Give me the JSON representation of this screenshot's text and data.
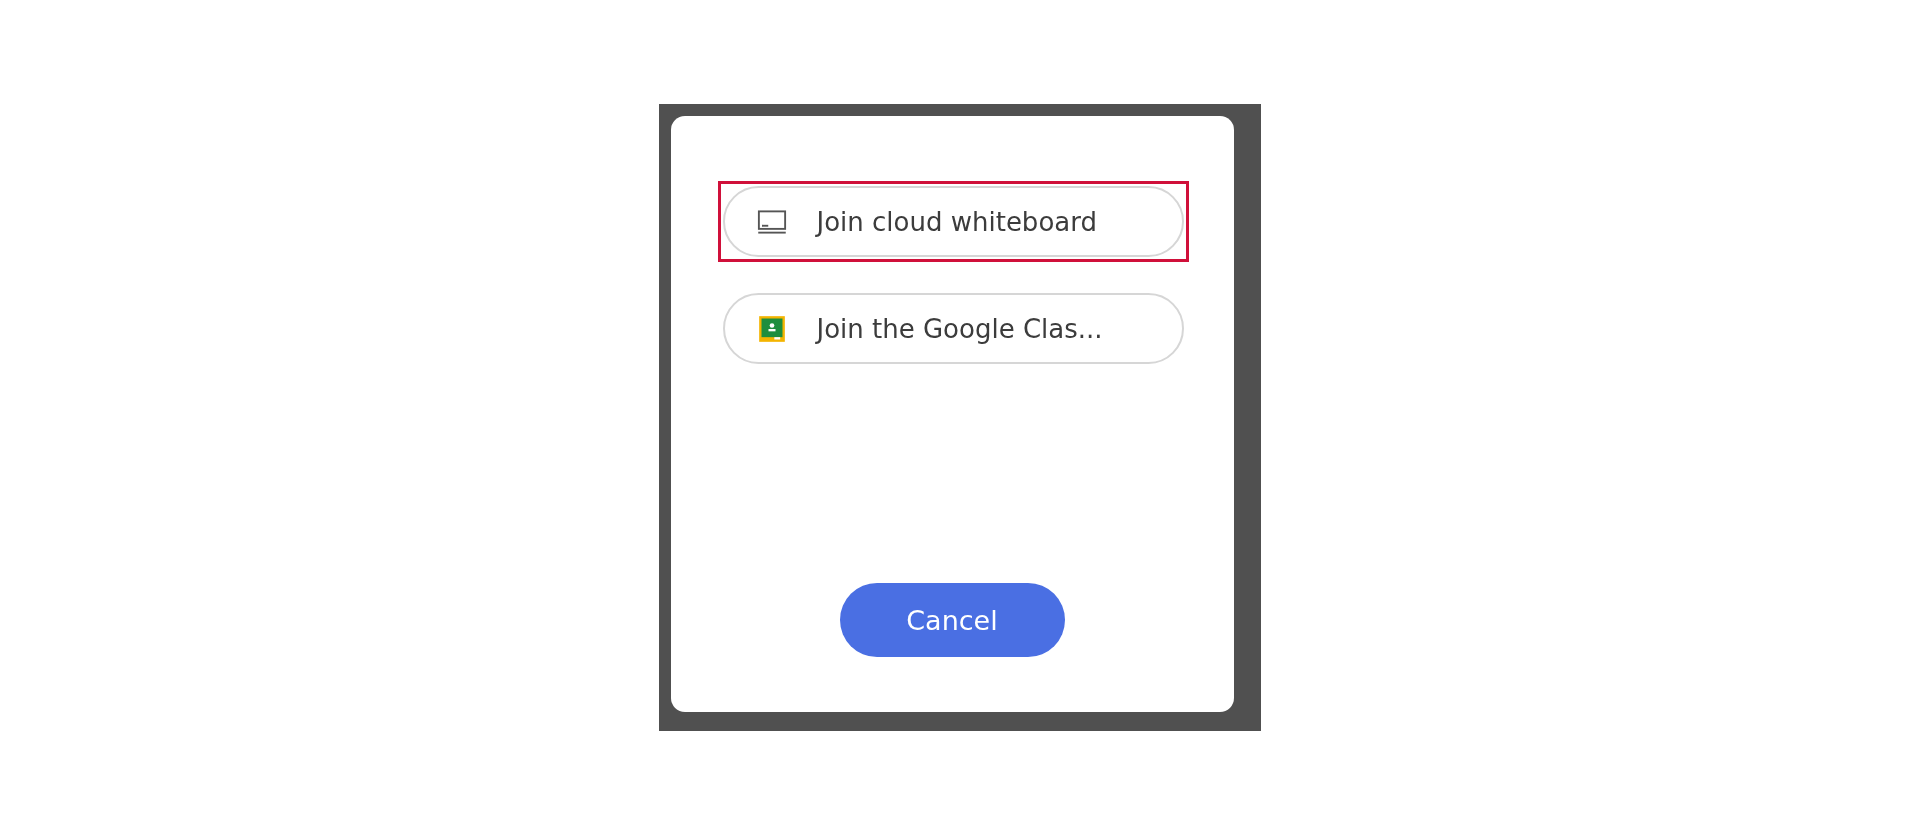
{
  "options": [
    {
      "kind": "whiteboard",
      "label": "Join cloud whiteboard",
      "highlighted": true
    },
    {
      "kind": "classroom",
      "label": "Join the Google Clas...",
      "highlighted": false
    }
  ],
  "cancel_button": {
    "label": "Cancel"
  }
}
